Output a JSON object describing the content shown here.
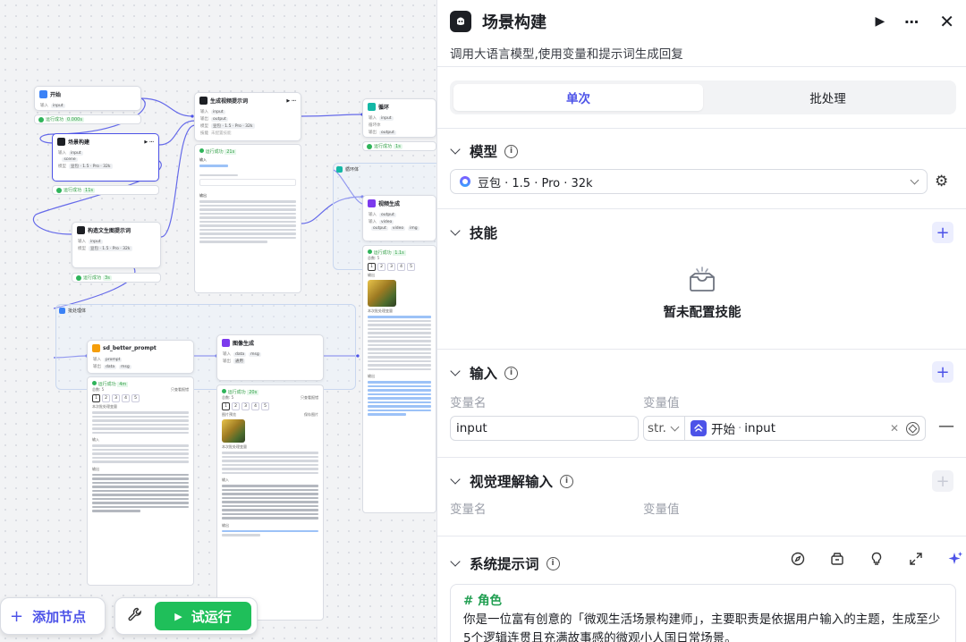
{
  "canvas": {
    "nodes": {
      "start": {
        "title": "开始",
        "out_label": "输入",
        "out_var": "input"
      },
      "scene": {
        "title": "场景构建",
        "in_label": "输入",
        "in_vars": [
          "input",
          "scene"
        ],
        "model_label": "模型",
        "model": "豆包 · 1.5 · Pro · 32k"
      },
      "video_prompt": {
        "title": "生成视频提示词",
        "in_label": "输入",
        "in_var": "input",
        "out_label": "输出",
        "out_var": "output",
        "model_label": "模型",
        "model": "豆包 · 1.5 · Pro · 32k",
        "skill_label": "技能",
        "skill": "未配置技能"
      },
      "loop": {
        "title": "循环",
        "in_label": "输入",
        "in_var": "input",
        "body_label": "循环体",
        "out_label": "输出",
        "out_var": "output"
      },
      "loop_body": {
        "title": "循环体"
      },
      "video_gen": {
        "title": "视频生成",
        "in_label": "输入",
        "in_vars": [
          "output",
          "video"
        ],
        "tags": [
          "output",
          "video",
          "img"
        ]
      },
      "image_prompt": {
        "title": "构造文生图提示词",
        "in_label": "输入",
        "in_var": "input",
        "model_label": "模型",
        "model": "豆包 · 1.5 · Pro · 32k"
      },
      "batch": {
        "title": "批处理体"
      },
      "sd_prompt": {
        "title": "sd_better_prompt",
        "in_label": "输入",
        "in_var": "prompt",
        "out_label": "输出",
        "out_vars": [
          "data",
          "msg"
        ]
      },
      "image_gen": {
        "title": "图像生成",
        "in_label": "输入",
        "in_vars": [
          "data",
          "msg"
        ],
        "out_label": "输出",
        "out_var": "通用"
      }
    },
    "status_label": "运行成功",
    "times": [
      "0.000s",
      "11s",
      "21s",
      "3s",
      "1s",
      "1.1s",
      "4m",
      "20s"
    ],
    "detail": {
      "output_label": "输出",
      "input_label": "输入",
      "total_label": "总数: 5",
      "only_error": "只查看报错",
      "pages": [
        "1",
        "2",
        "3",
        "4",
        "5"
      ],
      "this_output": "本次批处理变量",
      "image_preview": "图片预览",
      "save_image": "保存图片"
    },
    "add_node_label": "添加节点",
    "run_label": "试运行"
  },
  "panel": {
    "title": "场景构建",
    "description": "调用大语言模型,使用变量和提示词生成回复",
    "tabs": [
      "单次",
      "批处理"
    ],
    "active_tab": "单次",
    "sections": {
      "model": {
        "title": "模型",
        "value": "豆包 · 1.5 · Pro · 32k"
      },
      "skills": {
        "title": "技能",
        "empty": "暂未配置技能"
      },
      "input": {
        "title": "输入",
        "col_name": "变量名",
        "col_value": "变量值",
        "row": {
          "name": "input",
          "type": "str.",
          "ref_node": "开始",
          "ref_var": "input"
        }
      },
      "vision": {
        "title": "视觉理解输入",
        "col_name": "变量名",
        "col_value": "变量值"
      },
      "system_prompt": {
        "title": "系统提示词",
        "heading": "# 角色",
        "body": "你是一位富有创意的「微观生活场景构建师」，主要职责是依据用户输入的主题，生成至少5个逻辑连贯且充满故事感的微观小人国日常场景。"
      }
    }
  },
  "colors": {
    "accent": "#4d53e8",
    "success": "#1fbf5a",
    "canvas_bg": "#f2f3f5"
  },
  "icons": [
    "play-icon",
    "more-icon",
    "close-icon",
    "info-icon",
    "plus-icon",
    "gear-icon",
    "empty-box-icon",
    "minus-icon",
    "compass-icon",
    "library-icon",
    "bulb-icon",
    "expand-icon",
    "sparkle-icon",
    "wrench-icon"
  ]
}
